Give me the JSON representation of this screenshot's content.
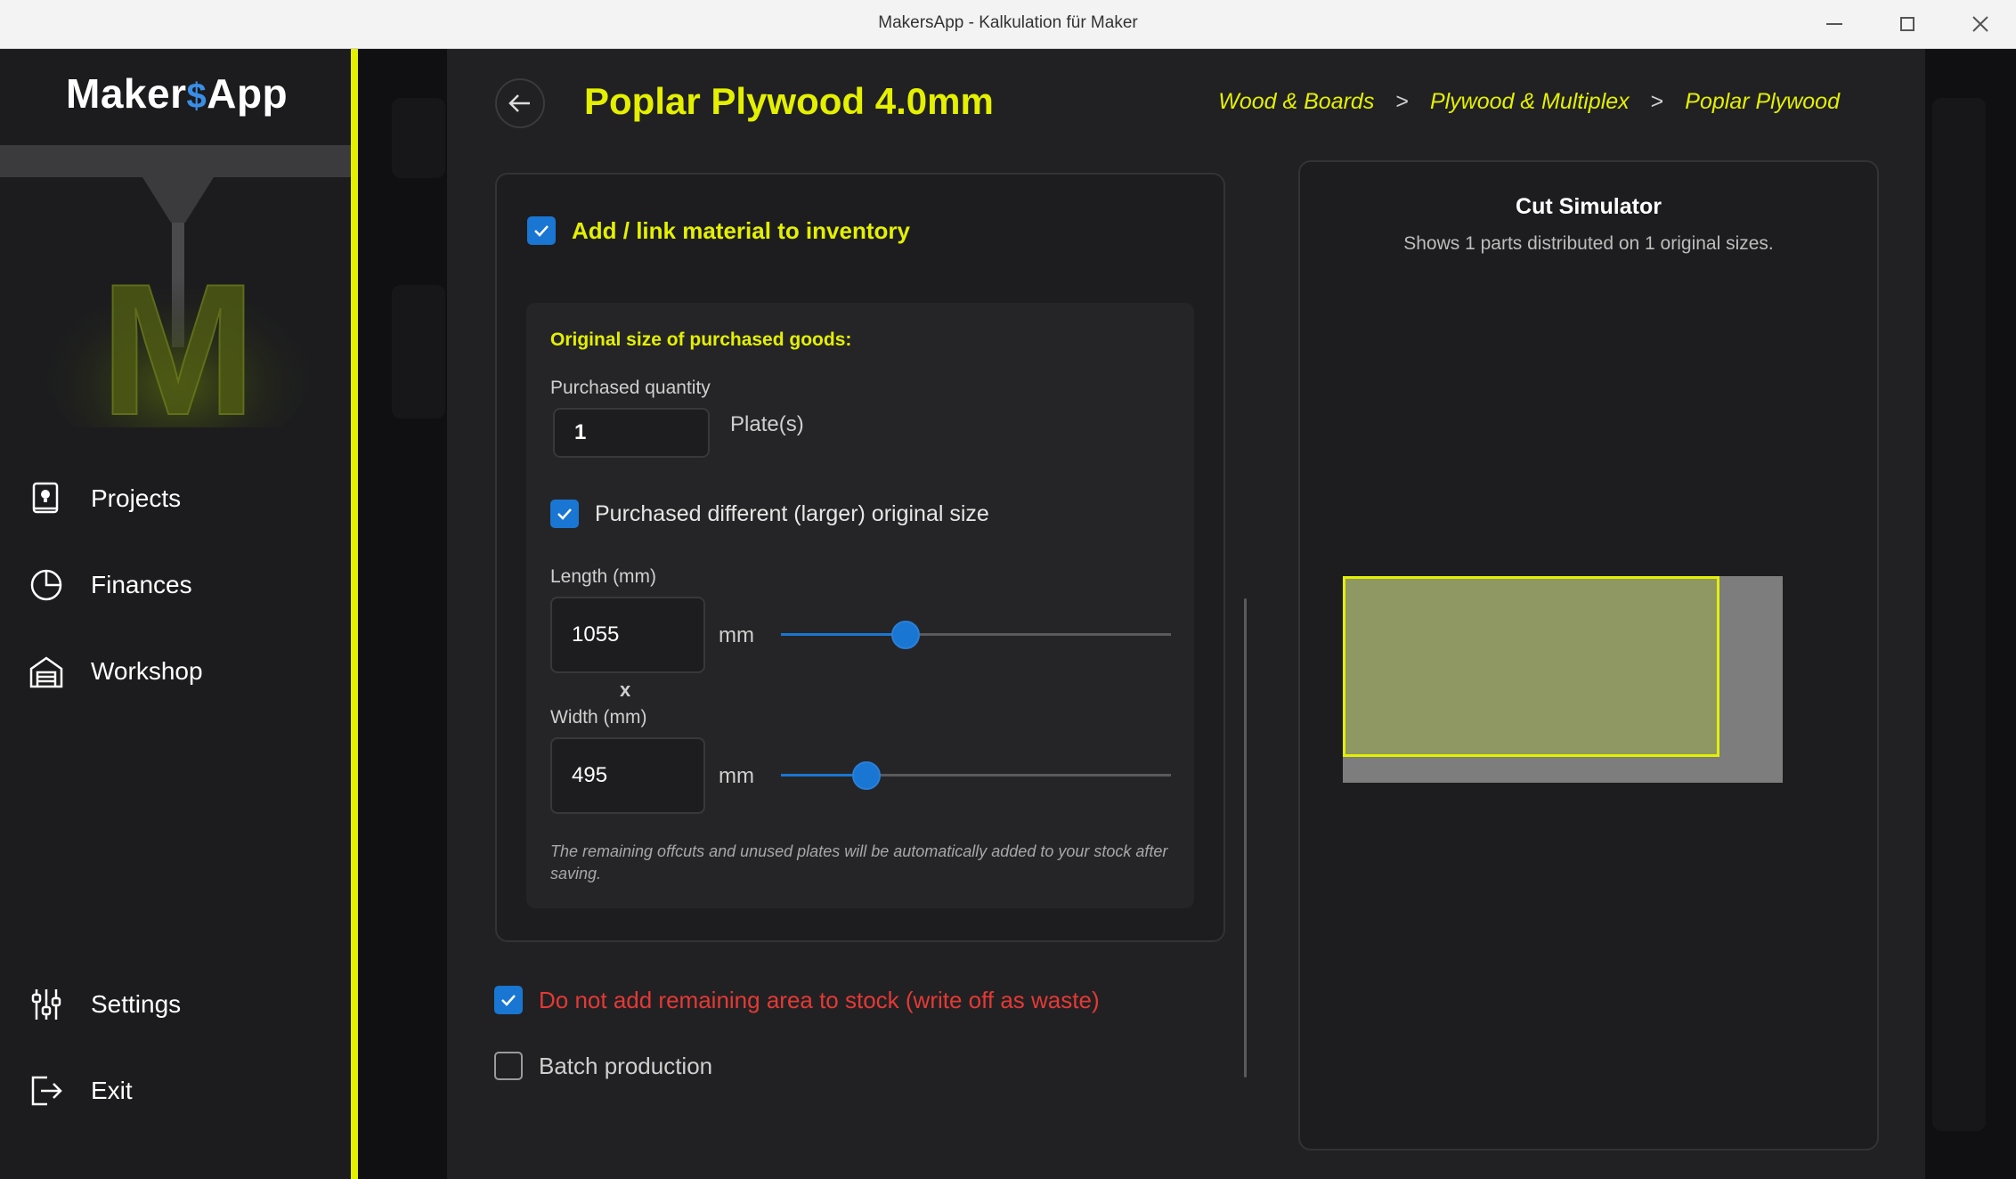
{
  "window": {
    "title": "MakersApp - Kalkulation für Maker"
  },
  "sidebar": {
    "logo": {
      "part1": "Maker",
      "dollar": "$",
      "part2": "App",
      "letter": "M"
    },
    "items": [
      {
        "label": "Projects",
        "icon": "book-lightbulb-icon"
      },
      {
        "label": "Finances",
        "icon": "pie-chart-icon"
      },
      {
        "label": "Workshop",
        "icon": "garage-icon"
      },
      {
        "label": "Settings",
        "icon": "sliders-icon"
      },
      {
        "label": "Exit",
        "icon": "exit-icon"
      }
    ]
  },
  "dialog": {
    "title": "Poplar Plywood 4.0mm",
    "breadcrumb": [
      "Wood & Boards",
      "Plywood & Multiplex",
      "Poplar Plywood"
    ],
    "breadcrumb_sep": ">",
    "add_link": {
      "label": "Add / link material to inventory",
      "checked": true
    },
    "original_size_title": "Original size of purchased goods:",
    "purchased_quantity": {
      "label": "Purchased quantity",
      "value": "1",
      "unit": "Plate(s)"
    },
    "different_size": {
      "label": "Purchased different (larger) original size",
      "checked": true
    },
    "length": {
      "label": "Length (mm)",
      "value": "1055",
      "unit": "mm",
      "slider_fraction": 0.32
    },
    "times_sign": "x",
    "width": {
      "label": "Width (mm)",
      "value": "495",
      "unit": "mm",
      "slider_fraction": 0.22
    },
    "note": "The remaining offcuts and unused plates will be automatically added to your stock after saving.",
    "write_off": {
      "label": "Do not add remaining area to stock (write off as waste)",
      "checked": true
    },
    "batch": {
      "label": "Batch production",
      "checked": false
    }
  },
  "cut_simulator": {
    "title": "Cut Simulator",
    "subtitle": "Shows 1 parts distributed on 1 original sizes."
  },
  "colors": {
    "accent": "#e4f000",
    "primary": "#1976d2",
    "danger": "#e53935"
  }
}
